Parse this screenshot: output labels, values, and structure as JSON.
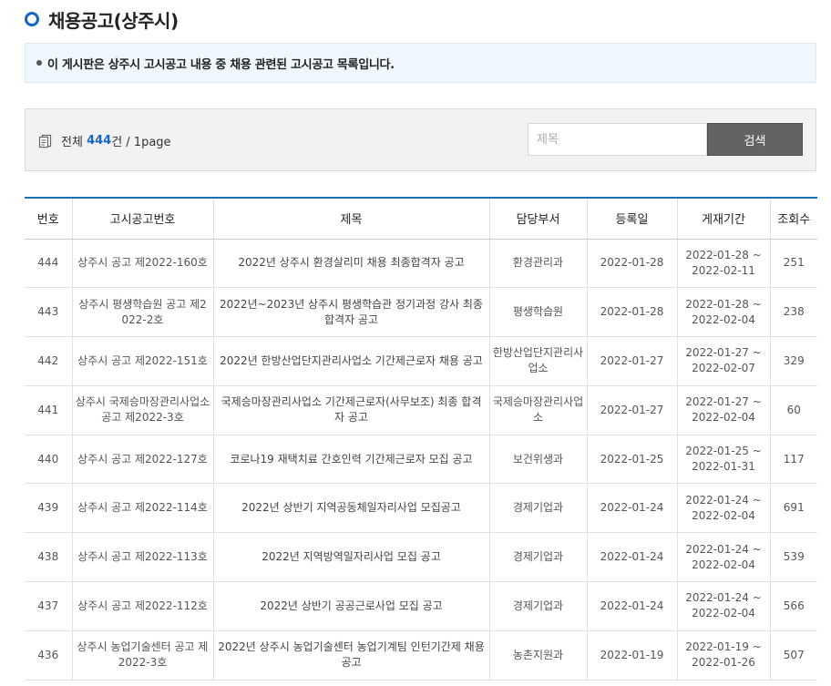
{
  "page": {
    "title": "채용공고(상주시)"
  },
  "notice": {
    "text": "이 게시판은 상주시 고시공고 내용 중 채용 관련된 고시공고 목록입니다."
  },
  "summary": {
    "prefix": "전체",
    "count": "444",
    "suffix": "건 / 1page"
  },
  "search": {
    "placeholder": "제목",
    "button_label": "검색"
  },
  "table": {
    "headers": [
      "번호",
      "고시공고번호",
      "제목",
      "담당부서",
      "등록일",
      "게재기간",
      "조회수"
    ],
    "rows": [
      {
        "no": "444",
        "notice_no": "상주시 공고 제2022-160호",
        "title": "2022년 상주시 환경살리미 채용 최종합격자 공고",
        "dept": "환경관리과",
        "date": "2022-01-28",
        "period": "2022-01-28 ~ 2022-02-11",
        "views": "251"
      },
      {
        "no": "443",
        "notice_no": "상주시 평생학습원 공고 제2022-2호",
        "title": "2022년~2023년 상주시 평생학습관 정기과정 강사 최종 합격자 공고",
        "dept": "평생학습원",
        "date": "2022-01-28",
        "period": "2022-01-28 ~ 2022-02-04",
        "views": "238"
      },
      {
        "no": "442",
        "notice_no": "상주시 공고 제2022-151호",
        "title": "2022년 한방산업단지관리사업소 기간제근로자 채용 공고",
        "dept": "한방산업단지관리사업소",
        "date": "2022-01-27",
        "period": "2022-01-27 ~ 2022-02-07",
        "views": "329"
      },
      {
        "no": "441",
        "notice_no": "상주시 국제승마장관리사업소 공고 제2022-3호",
        "title": "국제승마장관리사업소 기간제근로자(사무보조) 최종 합격자 공고",
        "dept": "국제승마장관리사업소",
        "date": "2022-01-27",
        "period": "2022-01-27 ~ 2022-02-04",
        "views": "60"
      },
      {
        "no": "440",
        "notice_no": "상주시 공고 제2022-127호",
        "title": "코로나19 재택치료 간호인력 기간제근로자 모집 공고",
        "dept": "보건위생과",
        "date": "2022-01-25",
        "period": "2022-01-25 ~ 2022-01-31",
        "views": "117"
      },
      {
        "no": "439",
        "notice_no": "상주시 공고 제2022-114호",
        "title": "2022년 상반기 지역공동체일자리사업 모집공고",
        "dept": "경제기업과",
        "date": "2022-01-24",
        "period": "2022-01-24 ~ 2022-02-04",
        "views": "691"
      },
      {
        "no": "438",
        "notice_no": "상주시 공고 제2022-113호",
        "title": "2022년 지역방역일자리사업 모집 공고",
        "dept": "경제기업과",
        "date": "2022-01-24",
        "period": "2022-01-24 ~ 2022-02-04",
        "views": "539"
      },
      {
        "no": "437",
        "notice_no": "상주시 공고 제2022-112호",
        "title": "2022년 상반기 공공근로사업 모집 공고",
        "dept": "경제기업과",
        "date": "2022-01-24",
        "period": "2022-01-24 ~ 2022-02-04",
        "views": "566"
      },
      {
        "no": "436",
        "notice_no": "상주시 농업기술센터 공고 제2022-3호",
        "title": "2022년 상주시 농업기술센터 농업기계팀 인턴기간제 채용공고",
        "dept": "농촌지원과",
        "date": "2022-01-19",
        "period": "2022-01-19 ~ 2022-01-26",
        "views": "507"
      }
    ]
  },
  "colors": {
    "accent": "#1766c2",
    "header_border": "#1c6fb9",
    "notice_bg": "#eef7fc",
    "button_bg": "#636363"
  },
  "icons": {
    "title": "circle-bullet-icon",
    "count": "document-icon"
  }
}
